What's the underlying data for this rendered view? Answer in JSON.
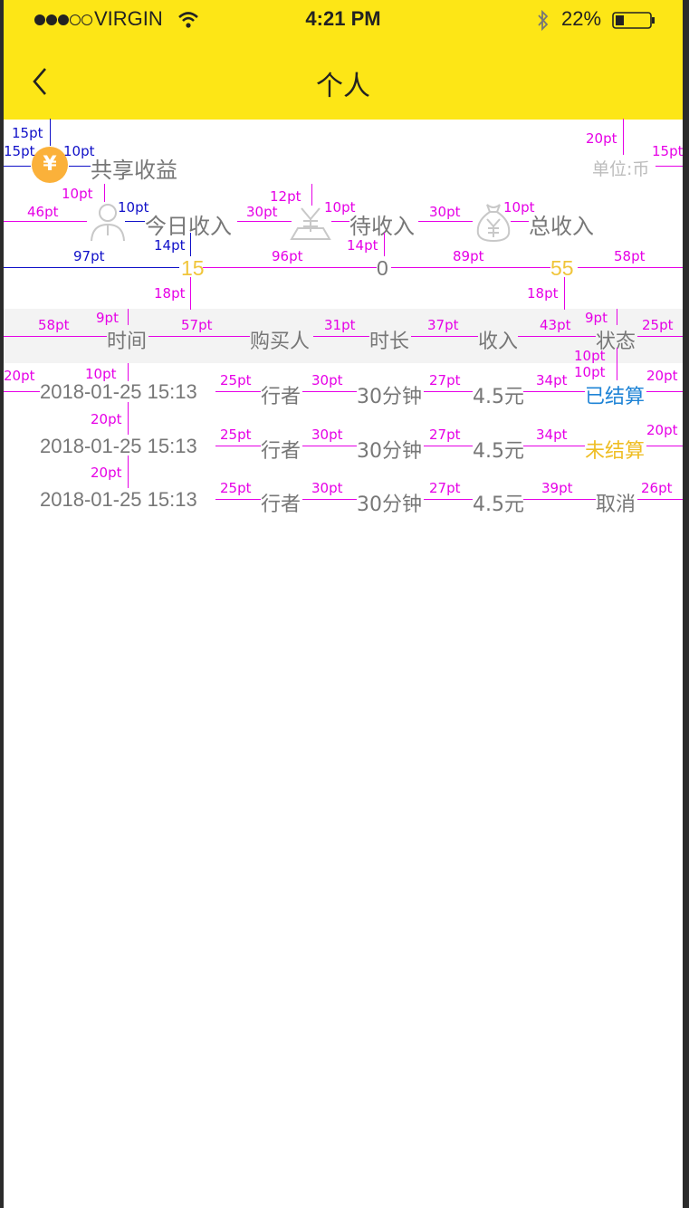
{
  "status_bar": {
    "carrier": "VIRGIN",
    "time": "4:21 PM",
    "battery_pct": "22%"
  },
  "nav": {
    "title": "个人",
    "back_icon": "chevron-left-icon"
  },
  "section": {
    "title": "共享收益",
    "unit": "单位:币",
    "coin_symbol": "¥"
  },
  "stats": [
    {
      "label": "今日收入",
      "value": "15",
      "icon": "user-icon"
    },
    {
      "label": "待收入",
      "value": "0",
      "icon": "money-tray-icon"
    },
    {
      "label": "总收入",
      "value": "55",
      "icon": "money-bag-icon"
    }
  ],
  "table": {
    "headers": [
      "时间",
      "购买人",
      "时长",
      "收入",
      "状态"
    ],
    "rows": [
      {
        "time": "2018-01-25 15:13",
        "buyer": "行者",
        "duration": "30分钟",
        "income": "4.5元",
        "status": "已结算",
        "status_color": "#1f84d6"
      },
      {
        "time": "2018-01-25 15:13",
        "buyer": "行者",
        "duration": "30分钟",
        "income": "4.5元",
        "status": "未结算",
        "status_color": "#efbe24"
      },
      {
        "time": "2018-01-25 15:13",
        "buyer": "行者",
        "duration": "30分钟",
        "income": "4.5元",
        "status": "取消",
        "status_color": "#777777"
      }
    ]
  },
  "annotations": {
    "a15pt_top": "15pt",
    "a15pt_left": "15pt",
    "a10pt_icon": "10pt",
    "a10pt_below": "10pt",
    "a20pt_right": "20pt",
    "a15pt_right": "15pt",
    "a46pt": "46pt",
    "a10pt_stat": "10pt",
    "a30pt_1": "30pt",
    "a12pt": "12pt",
    "a10pt_2": "10pt",
    "a30pt_2": "30pt",
    "a10pt_3": "10pt",
    "a97pt": "97pt",
    "a14pt_1": "14pt",
    "a96pt": "96pt",
    "a14pt_2": "14pt",
    "a89pt": "89pt",
    "a58pt_1": "58pt",
    "a18pt_1": "18pt",
    "a18pt_2": "18pt",
    "a58pt_2": "58pt",
    "a9pt_1": "9pt",
    "a57pt": "57pt",
    "a31pt": "31pt",
    "a37pt": "37pt",
    "a43pt": "43pt",
    "a9pt_2": "9pt",
    "a25pt_h": "25pt",
    "a10pt_s1": "10pt",
    "a10pt_s2": "10pt",
    "a20pt_r1l": "20pt",
    "a10pt_r1": "10pt",
    "a25pt_r1": "25pt",
    "a30pt_r1": "30pt",
    "a27pt_r1": "27pt",
    "a34pt_r1": "34pt",
    "a20pt_r1r": "20pt",
    "a20pt_g1": "20pt",
    "a25pt_r2": "25pt",
    "a30pt_r2": "30pt",
    "a27pt_r2": "27pt",
    "a34pt_r2": "34pt",
    "a20pt_r2r": "20pt",
    "a20pt_g2": "20pt",
    "a25pt_r3": "25pt",
    "a30pt_r3": "30pt",
    "a27pt_r3": "27pt",
    "a39pt_r3": "39pt",
    "a26pt_r3": "26pt"
  }
}
